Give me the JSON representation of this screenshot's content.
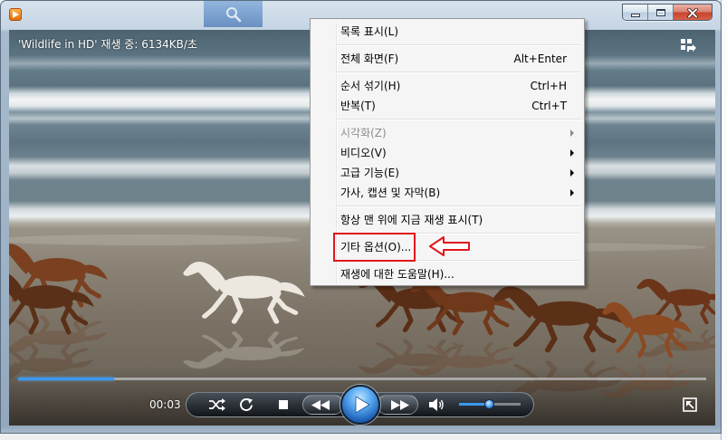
{
  "window": {
    "icons": [
      "media-player-icon",
      "minimize-icon",
      "maximize-icon",
      "close-icon"
    ]
  },
  "video": {
    "status_text": "'Wildlife in HD' 재생 중: 6134KB/초",
    "switch_icon": "switch-to-library-icon"
  },
  "player_controls": {
    "elapsed_time": "00:03",
    "seek_position": 0.14,
    "volume_level": 0.49,
    "icons": [
      "shuffle-icon",
      "repeat-icon",
      "stop-icon",
      "previous-icon",
      "play-icon",
      "next-icon",
      "volume-icon",
      "full-screen-icon"
    ]
  },
  "context_menu": {
    "items": [
      {
        "label": "목록 표시(L)",
        "shortcut": "",
        "submenu": false,
        "enabled": true
      },
      {
        "label": "전체 화면(F)",
        "shortcut": "Alt+Enter",
        "submenu": false,
        "enabled": true
      },
      {
        "label": "순서 섞기(H)",
        "shortcut": "Ctrl+H",
        "submenu": false,
        "enabled": true
      },
      {
        "label": "반복(T)",
        "shortcut": "Ctrl+T",
        "submenu": false,
        "enabled": true
      },
      {
        "label": "시각화(Z)",
        "shortcut": "",
        "submenu": true,
        "enabled": false
      },
      {
        "label": "비디오(V)",
        "shortcut": "",
        "submenu": true,
        "enabled": true
      },
      {
        "label": "고급 기능(E)",
        "shortcut": "",
        "submenu": true,
        "enabled": true
      },
      {
        "label": "가사, 캡션 및 자막(B)",
        "shortcut": "",
        "submenu": true,
        "enabled": true
      },
      {
        "label": "항상 맨 위에 지금 재생 표시(T)",
        "shortcut": "",
        "submenu": false,
        "enabled": true
      },
      {
        "label": "기타 옵션(O)...",
        "shortcut": "",
        "submenu": false,
        "enabled": true
      },
      {
        "label": "재생에 대한 도움말(H)...",
        "shortcut": "",
        "submenu": false,
        "enabled": true
      }
    ]
  },
  "annotation": {
    "color": "#e0161c"
  },
  "colors": {
    "accent": "#3a9af0",
    "close_button": "#c7432e"
  }
}
